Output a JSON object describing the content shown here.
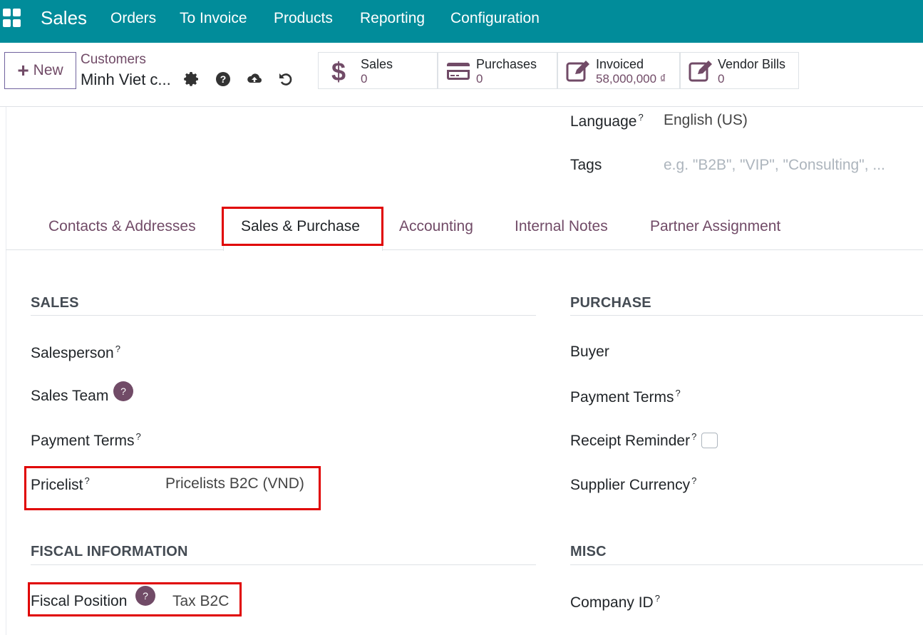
{
  "topnav": {
    "brand": "Sales",
    "menu": [
      "Orders",
      "To Invoice",
      "Products",
      "Reporting",
      "Configuration"
    ]
  },
  "control": {
    "new_label": "New",
    "breadcrumb_parent": "Customers",
    "breadcrumb_current": "Minh Viet c...",
    "icons": [
      "gear-icon",
      "help-icon",
      "cloud-upload-icon",
      "undo-icon"
    ]
  },
  "stats": [
    {
      "label": "Sales",
      "value": "0",
      "icon": "dollar-icon"
    },
    {
      "label": "Purchases",
      "value": "0",
      "icon": "credit-card-icon"
    },
    {
      "label": "Invoiced",
      "value": "58,000,000 ₫",
      "icon": "edit-icon"
    },
    {
      "label": "Vendor Bills",
      "value": "0",
      "icon": "edit-icon"
    }
  ],
  "upper_fields": {
    "language_label": "Language",
    "language_value": "English (US)",
    "tags_label": "Tags",
    "tags_placeholder": "e.g. \"B2B\", \"VIP\", \"Consulting\", ..."
  },
  "tabs": [
    "Contacts & Addresses",
    "Sales & Purchase",
    "Accounting",
    "Internal Notes",
    "Partner Assignment"
  ],
  "help_mark": "?",
  "sales": {
    "title": "SALES",
    "salesperson_label": "Salesperson",
    "sales_team_label": "Sales Team",
    "payment_terms_label": "Payment Terms",
    "pricelist_label": "Pricelist",
    "pricelist_value": "Pricelists B2C (VND)"
  },
  "purchase": {
    "title": "PURCHASE",
    "buyer_label": "Buyer",
    "payment_terms_label": "Payment Terms",
    "receipt_reminder_label": "Receipt Reminder",
    "supplier_currency_label": "Supplier Currency"
  },
  "fiscal": {
    "title": "FISCAL INFORMATION",
    "fiscal_position_label": "Fiscal Position",
    "fiscal_position_value": "Tax B2C"
  },
  "misc": {
    "title": "MISC",
    "company_id_label": "Company ID"
  },
  "colors": {
    "nav": "#018c9a",
    "accent": "#714b67",
    "highlight": "#e00000"
  }
}
